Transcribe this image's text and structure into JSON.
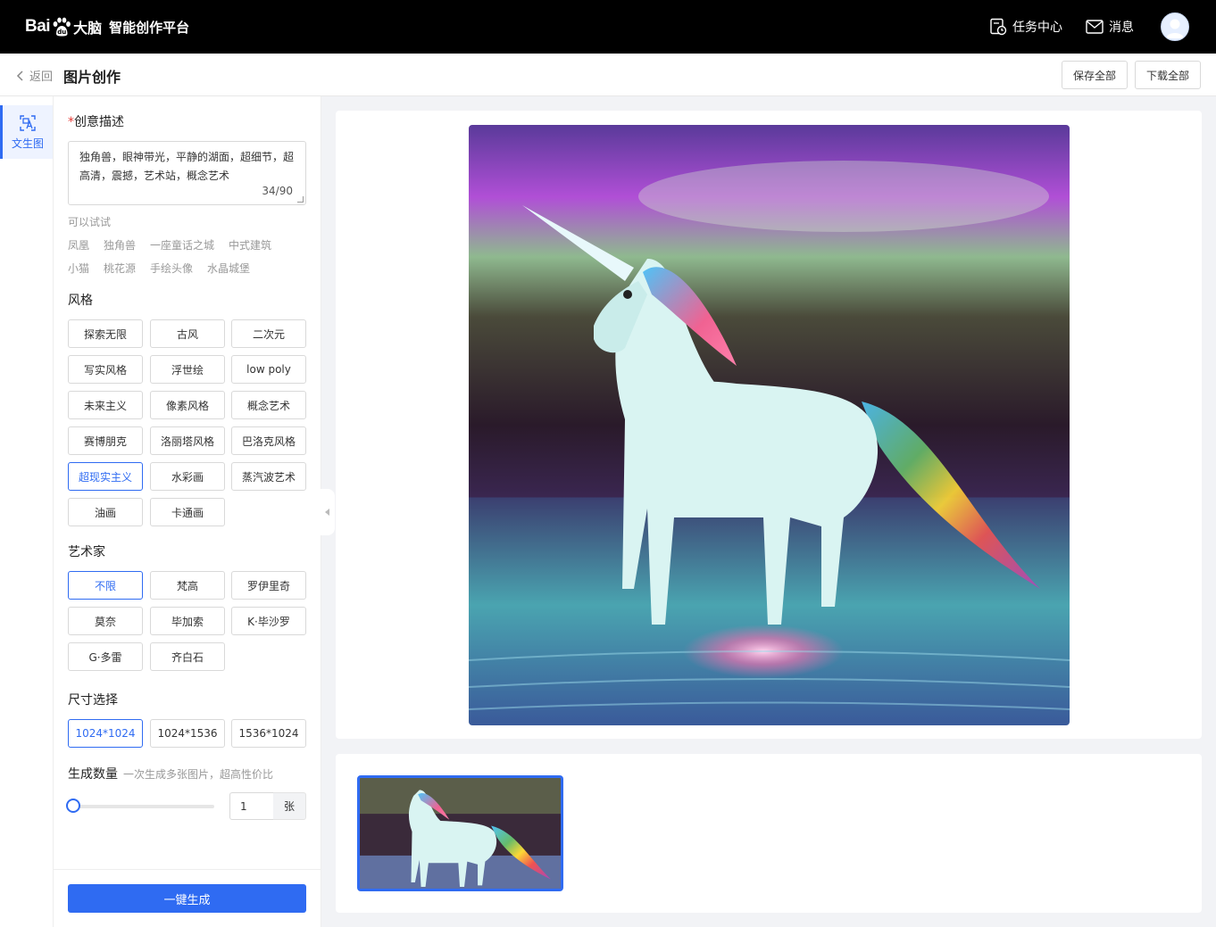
{
  "brand": {
    "logo_text_bai": "Bai",
    "logo_text_brain": "大脑",
    "platform": "智能创作平台"
  },
  "topnav": {
    "tasks": "任务中心",
    "messages": "消息"
  },
  "header": {
    "back": "返回",
    "title": "图片创作",
    "save_all": "保存全部",
    "download_all": "下载全部"
  },
  "rail": {
    "text_to_image": "文生图"
  },
  "prompt": {
    "label": "创意描述",
    "required_mark": "*",
    "value": "独角兽，眼神带光，平静的湖面，超细节，超高清，震撼，艺术站，概念艺术",
    "counter": "34/90"
  },
  "suggestions": {
    "label": "可以试试",
    "row1": [
      "凤凰",
      "独角兽",
      "一座童话之城",
      "中式建筑"
    ],
    "row2": [
      "小猫",
      "桃花源",
      "手绘头像",
      "水晶城堡"
    ]
  },
  "style": {
    "label": "风格",
    "options": [
      "探索无限",
      "古风",
      "二次元",
      "写实风格",
      "浮世绘",
      "low poly",
      "未来主义",
      "像素风格",
      "概念艺术",
      "赛博朋克",
      "洛丽塔风格",
      "巴洛克风格",
      "超现实主义",
      "水彩画",
      "蒸汽波艺术",
      "油画",
      "卡通画"
    ],
    "selected": "超现实主义"
  },
  "artist": {
    "label": "艺术家",
    "options": [
      "不限",
      "梵高",
      "罗伊里奇",
      "莫奈",
      "毕加索",
      "K·毕沙罗",
      "G·多雷",
      "齐白石"
    ],
    "selected": "不限"
  },
  "size": {
    "label": "尺寸选择",
    "options": [
      "1024*1024",
      "1024*1536",
      "1536*1024"
    ],
    "selected": "1024*1024"
  },
  "quantity": {
    "label": "生成数量",
    "hint": "一次生成多张图片，超高性价比",
    "value": "1",
    "unit": "张",
    "slider_fraction": 0
  },
  "generate_button": "一键生成",
  "colors": {
    "accent": "#2f6bf2",
    "topbar": "#000000",
    "background": "#f2f3f6"
  }
}
